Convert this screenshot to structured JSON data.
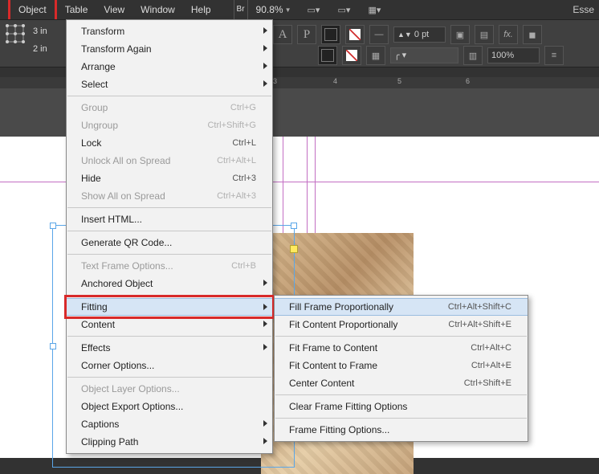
{
  "menubar": {
    "object": "Object",
    "table": "Table",
    "view": "View",
    "window": "Window",
    "help": "Help",
    "br": "Br",
    "zoom": "90.8%",
    "esse": "Esse"
  },
  "control_panel": {
    "x": "3 in",
    "y": "2 in",
    "stroke_pt": "0 pt",
    "opacity": "100%"
  },
  "ruler": {
    "ticks": [
      "3",
      "4",
      "5",
      "6"
    ]
  },
  "object_menu": [
    {
      "label": "Transform",
      "arrow": true
    },
    {
      "label": "Transform Again",
      "arrow": true
    },
    {
      "label": "Arrange",
      "arrow": true
    },
    {
      "label": "Select",
      "arrow": true
    },
    {
      "sep": true
    },
    {
      "label": "Group",
      "shortcut": "Ctrl+G",
      "disabled": true
    },
    {
      "label": "Ungroup",
      "shortcut": "Ctrl+Shift+G",
      "disabled": true
    },
    {
      "label": "Lock",
      "shortcut": "Ctrl+L"
    },
    {
      "label": "Unlock All on Spread",
      "shortcut": "Ctrl+Alt+L",
      "disabled": true
    },
    {
      "label": "Hide",
      "shortcut": "Ctrl+3"
    },
    {
      "label": "Show All on Spread",
      "shortcut": "Ctrl+Alt+3",
      "disabled": true
    },
    {
      "sep": true
    },
    {
      "label": "Insert HTML..."
    },
    {
      "sep": true
    },
    {
      "label": "Generate QR Code..."
    },
    {
      "sep": true
    },
    {
      "label": "Text Frame Options...",
      "shortcut": "Ctrl+B",
      "disabled": true
    },
    {
      "label": "Anchored Object",
      "arrow": true
    },
    {
      "sep": true
    },
    {
      "label": "Fitting",
      "arrow": true,
      "hover": true
    },
    {
      "label": "Content",
      "arrow": true
    },
    {
      "sep": true
    },
    {
      "label": "Effects",
      "arrow": true
    },
    {
      "label": "Corner Options..."
    },
    {
      "sep": true
    },
    {
      "label": "Object Layer Options...",
      "disabled": true
    },
    {
      "label": "Object Export Options..."
    },
    {
      "label": "Captions",
      "arrow": true
    },
    {
      "label": "Clipping Path",
      "arrow": true
    }
  ],
  "fitting_submenu": [
    {
      "label": "Fill Frame Proportionally",
      "shortcut": "Ctrl+Alt+Shift+C",
      "hover": true
    },
    {
      "label": "Fit Content Proportionally",
      "shortcut": "Ctrl+Alt+Shift+E"
    },
    {
      "sep": true
    },
    {
      "label": "Fit Frame to Content",
      "shortcut": "Ctrl+Alt+C"
    },
    {
      "label": "Fit Content to Frame",
      "shortcut": "Ctrl+Alt+E"
    },
    {
      "label": "Center Content",
      "shortcut": "Ctrl+Shift+E"
    },
    {
      "sep": true
    },
    {
      "label": "Clear Frame Fitting Options"
    },
    {
      "sep": true
    },
    {
      "label": "Frame Fitting Options..."
    }
  ]
}
